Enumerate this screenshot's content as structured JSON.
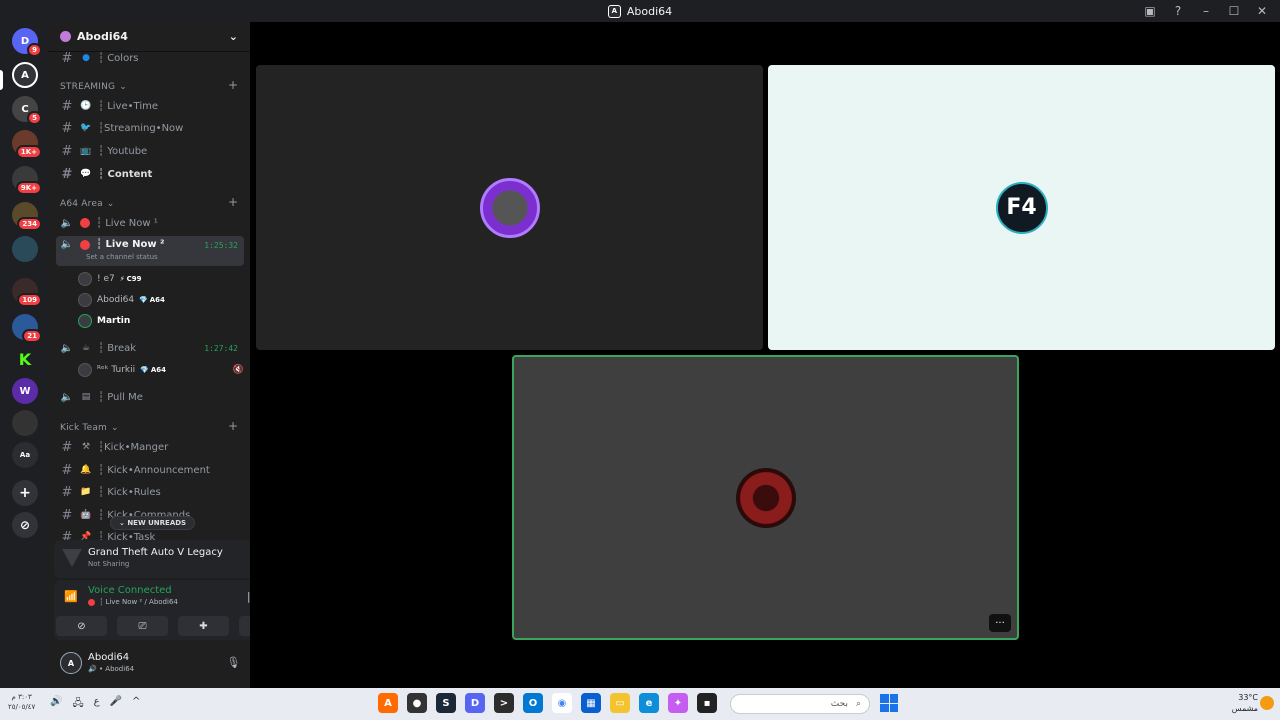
{
  "window": {
    "title": "Abodi64"
  },
  "rail": {
    "servers": [
      {
        "label": "D",
        "badge": "9"
      },
      {
        "label": "A",
        "badge": ""
      },
      {
        "label": "C",
        "badge": "5"
      },
      {
        "label": "",
        "badge": "1K+"
      },
      {
        "label": "",
        "badge": "9K+"
      },
      {
        "label": "",
        "badge": "234"
      },
      {
        "label": "",
        "badge": ""
      },
      {
        "label": "",
        "badge": "109"
      },
      {
        "label": "",
        "badge": "21"
      },
      {
        "label": "K",
        "badge": ""
      },
      {
        "label": "W",
        "badge": ""
      },
      {
        "label": "",
        "badge": ""
      },
      {
        "label": "Aa",
        "badge": ""
      },
      {
        "label": "+",
        "badge": ""
      },
      {
        "label": "⊘",
        "badge": ""
      }
    ]
  },
  "sidebar": {
    "guild_name": "Abodi64",
    "top_channel": "┆ Colors",
    "categories": {
      "streaming": "STREAMING",
      "a64": "A64 Area",
      "kick": "Kick Team"
    },
    "streaming_channels": [
      {
        "emoji": "🕒",
        "name": "┆ Live•Time"
      },
      {
        "emoji": "🐦",
        "name": "┆Streaming•Now"
      },
      {
        "emoji": "📺",
        "name": "┆ Youtube"
      },
      {
        "emoji": "💬",
        "name": "┆ Content"
      }
    ],
    "voice_channels": {
      "live_now_1": {
        "name": "┆ Live Now ¹"
      },
      "live_now_2": {
        "name": "┆ Live Now ²",
        "time": "1:25:32",
        "status": "Set a channel status"
      },
      "break": {
        "name": "┆ Break",
        "time": "1:27:42"
      },
      "pull_me": {
        "name": "┆ Pull Me"
      }
    },
    "voice_users_live2": [
      {
        "name": "! e7",
        "tag": "C99"
      },
      {
        "name": "Abodi64",
        "tag": "A64"
      },
      {
        "name": "Martin",
        "tag": ""
      }
    ],
    "voice_users_break": [
      {
        "name": "ᴿᵉᵏ Turkii",
        "tag": "A64"
      }
    ],
    "kick_channels": [
      {
        "emoji": "⚒",
        "name": "┆Kick•Manger"
      },
      {
        "emoji": "🔔",
        "name": "┆ Kick•Announcement"
      },
      {
        "emoji": "📁",
        "name": "┆ Kick•Rules"
      },
      {
        "emoji": "🤖",
        "name": "┆ Kick•Commands"
      },
      {
        "emoji": "📌",
        "name": "┆ Kick•Task"
      }
    ],
    "new_unreads": "NEW UNREADS"
  },
  "activity": {
    "game": "Grand Theft Auto V Legacy",
    "status": "Not Sharing"
  },
  "voice": {
    "title": "Voice Connected",
    "channel": "┆ Live Now ² / Abodi64"
  },
  "user": {
    "name": "Abodi64",
    "sub": "Abodi64"
  },
  "stage": {
    "tile1_initial": "",
    "tile2_initial": "F4",
    "tile3_initial": "",
    "more_label": "···"
  },
  "taskbar": {
    "time": "٣:٠٣ م",
    "date": "٢٥/٠٥/٤٧",
    "lang": "ع",
    "search_placeholder": "بحث",
    "weather_temp": "33°C",
    "weather_desc": "مشمس"
  },
  "colors": {
    "accent_green": "#23a55a",
    "live_red": "#f23f43",
    "speaking_border": "#3ba55d"
  }
}
